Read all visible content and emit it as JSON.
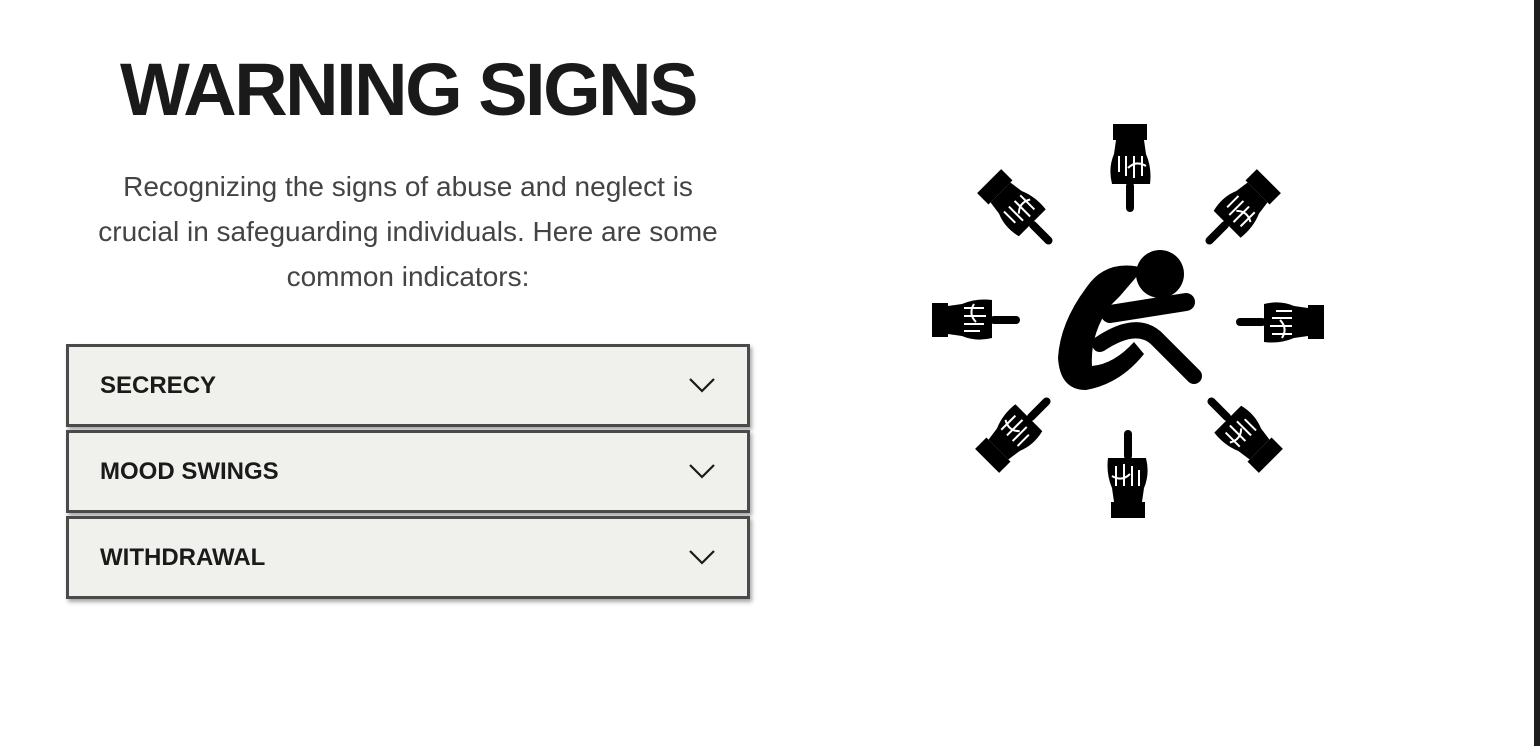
{
  "header": {
    "title": "WARNING SIGNS",
    "intro": "Recognizing the signs of abuse and neglect is crucial in safeguarding individuals. Here are some common indicators:"
  },
  "accordion": {
    "items": [
      {
        "label": "SECRECY",
        "icon": "chevron-down-icon",
        "expanded": false
      },
      {
        "label": "MOOD SWINGS",
        "icon": "chevron-down-icon",
        "expanded": false
      },
      {
        "label": "WITHDRAWAL",
        "icon": "chevron-down-icon",
        "expanded": false
      }
    ]
  },
  "illustration": {
    "icon": "person-surrounded-by-pointing-hands-icon",
    "color": "#000000"
  },
  "colors": {
    "heading": "#1a1a1a",
    "body_text": "#444444",
    "accordion_bg": "#f0f0ec",
    "accordion_border": "#4a4a4a"
  }
}
